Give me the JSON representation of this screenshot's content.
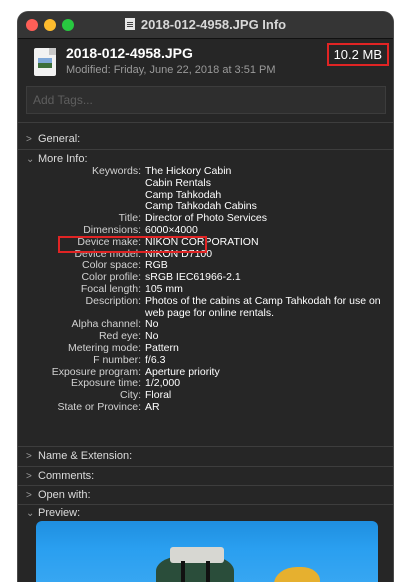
{
  "window": {
    "title": "2018-012-4958.JPG Info"
  },
  "file": {
    "name": "2018-012-4958.JPG",
    "modified": "Modified: Friday, June 22, 2018 at 3:51 PM",
    "size": "10.2 MB"
  },
  "tags": {
    "placeholder": "Add Tags..."
  },
  "sections": {
    "general": "General:",
    "more_info": "More Info:",
    "name_extension": "Name & Extension:",
    "comments": "Comments:",
    "open_with": "Open with:",
    "preview": "Preview:"
  },
  "more_info": [
    {
      "key": "Keywords:",
      "value": "The Hickory Cabin"
    },
    {
      "key": "",
      "value": "Cabin Rentals"
    },
    {
      "key": "",
      "value": "Camp Tahkodah"
    },
    {
      "key": "",
      "value": "Camp Tahkodah Cabins"
    },
    {
      "key": "Title:",
      "value": "Director of Photo Services"
    },
    {
      "key": "Dimensions:",
      "value": "6000×4000"
    },
    {
      "key": "Device make:",
      "value": "NIKON CORPORATION"
    },
    {
      "key": "Device model:",
      "value": "NIKON D7100"
    },
    {
      "key": "Color space:",
      "value": "RGB"
    },
    {
      "key": "Color profile:",
      "value": "sRGB IEC61966-2.1"
    },
    {
      "key": "Focal length:",
      "value": "105 mm"
    },
    {
      "key": "Description:",
      "value": "Photos of the cabins at Camp Tahkodah for use on"
    },
    {
      "key": "",
      "value": "web page for online rentals."
    },
    {
      "key": "Alpha channel:",
      "value": "No"
    },
    {
      "key": "Red eye:",
      "value": "No"
    },
    {
      "key": "Metering mode:",
      "value": "Pattern"
    },
    {
      "key": "F number:",
      "value": "f/6.3"
    },
    {
      "key": "Exposure program:",
      "value": "Aperture priority"
    },
    {
      "key": "Exposure time:",
      "value": "1/2,000"
    },
    {
      "key": "City:",
      "value": "Floral"
    },
    {
      "key": "State or Province:",
      "value": "AR"
    }
  ],
  "colors": {
    "highlight": "#e02424",
    "window_bg": "#262626"
  },
  "icons": {
    "collapsed": "chevron-right-icon",
    "expanded": "chevron-down-icon"
  }
}
